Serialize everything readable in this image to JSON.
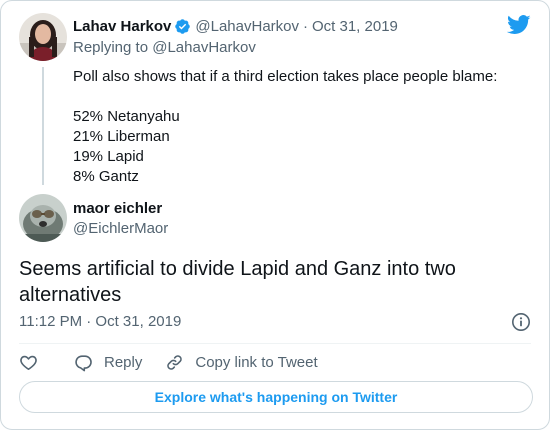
{
  "parent_tweet": {
    "author_name": "Lahav Harkov",
    "author_handle": "@LahavHarkov",
    "separator": "·",
    "date": "Oct 31, 2019",
    "replying_prefix": "Replying to",
    "replying_handle": "@LahavHarkov",
    "text_intro": "Poll also shows that if a third election takes place people blame:",
    "lines": [
      "52% Netanyahu",
      "21% Liberman",
      "19% Lapid",
      "8% Gantz"
    ]
  },
  "main_tweet": {
    "author_name": "maor eichler",
    "author_handle": "@EichlerMaor",
    "text": "Seems artificial to divide Lapid and Ganz into two alternatives",
    "timestamp": "11:12 PM · Oct 31, 2019"
  },
  "actions": {
    "reply_label": "Reply",
    "copy_label": "Copy link to Tweet"
  },
  "explore_label": "Explore what's happening on Twitter",
  "colors": {
    "twitter_blue": "#1d9bf0",
    "text_primary": "#0f1419",
    "text_secondary": "#536471",
    "border": "#cfd9de"
  },
  "icons": [
    "verified-badge-icon",
    "twitter-bird-icon",
    "info-icon",
    "heart-icon",
    "reply-icon",
    "link-icon"
  ]
}
